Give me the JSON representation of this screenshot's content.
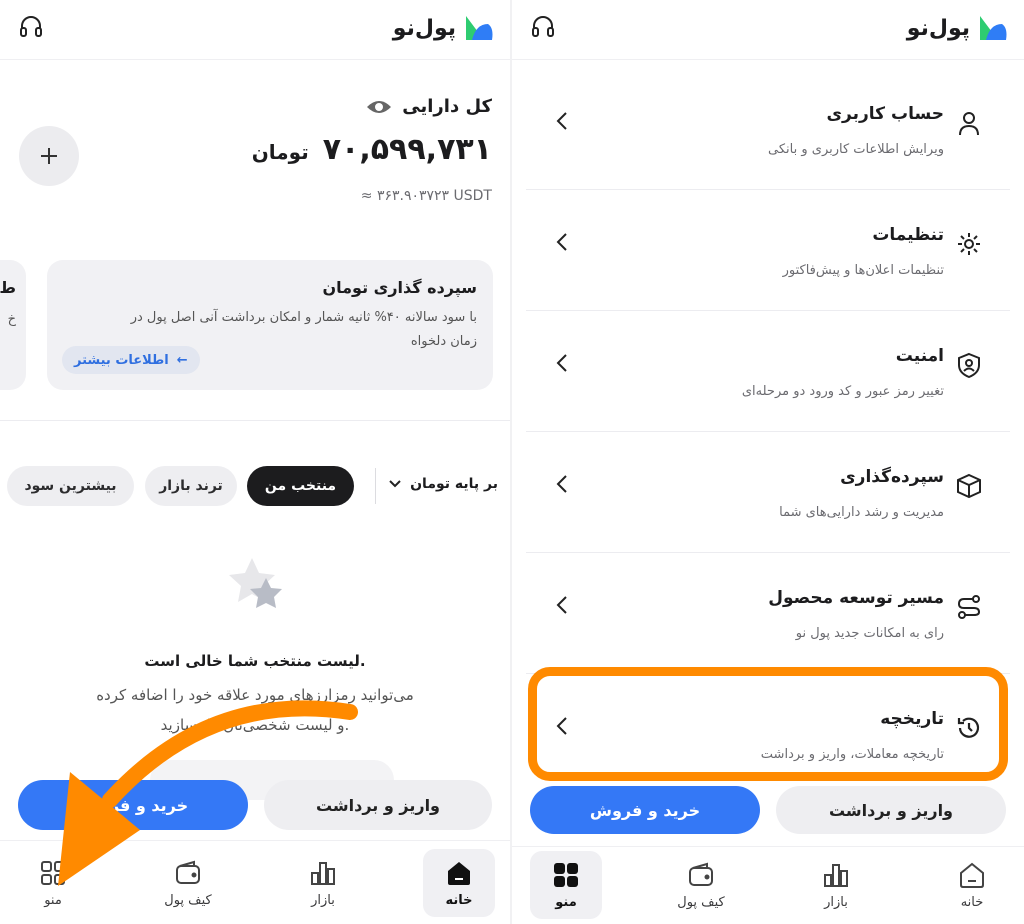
{
  "brand": {
    "name": "پول‌نو"
  },
  "left": {
    "assets": {
      "label": "کل دارایی",
      "amount": "۷۰,۵۹۹,۷۳۱",
      "currency": "تومان",
      "usdt": "≈ ۳۶۳.۹۰۳۷۲۳ USDT"
    },
    "promo": {
      "title": "سپرده گذاری تومان",
      "line1": "با سود سالانه ۴۰% ثانیه شمار و امکان برداشت آنی اصل پول در",
      "line2": "زمان دلخواه",
      "link": "اطلاعات بیشتر",
      "edge_title": "ط",
      "edge_line": "خ"
    },
    "filters": {
      "base": "بر پایه تومان",
      "chips": [
        "منتخب من",
        "ترند بازار",
        "بیشترین سود"
      ]
    },
    "empty": {
      "title": "لیست منتخب شما خالی است.",
      "line1": "می‌توانید رمزارزهای مورد علاقه خود را اضافه کرده",
      "line2": "و لیست شخصی‌تان را بسازید."
    },
    "actions": {
      "deposit": "واریز و برداشت",
      "trade": "خرید و فروش"
    }
  },
  "right": {
    "menu": [
      {
        "title": "حساب کاربری",
        "subtitle": "ویرایش اطلاعات کاربری و بانکی",
        "icon": "user-icon"
      },
      {
        "title": "تنظیمات",
        "subtitle": "تنظیمات اعلان‌ها و پیش‌فاکتور",
        "icon": "gear-icon"
      },
      {
        "title": "امنیت",
        "subtitle": "تغییر رمز عبور و کد ورود دو مرحله‌ای",
        "icon": "shield-user-icon"
      },
      {
        "title": "سپرده‌گذاری",
        "subtitle": "مدیریت و رشد دارایی‌های شما",
        "icon": "box-icon"
      },
      {
        "title": "مسیر توسعه محصول",
        "subtitle": "رای به امکانات جدید پول نو",
        "icon": "route-icon"
      },
      {
        "title": "تاریخچه",
        "subtitle": "تاریخچه معاملات، واریز و برداشت",
        "icon": "history-icon"
      }
    ],
    "actions": {
      "deposit": "واریز و برداشت",
      "trade": "خرید و فروش"
    }
  },
  "tabs": [
    {
      "label": "خانه",
      "icon": "home-icon"
    },
    {
      "label": "بازار",
      "icon": "market-chart-icon"
    },
    {
      "label": "کیف پول",
      "icon": "wallet-icon"
    },
    {
      "label": "منو",
      "icon": "grid-menu-icon"
    }
  ],
  "colors": {
    "accent_blue": "#3478f6",
    "annotation_orange": "#ff8a00",
    "chip_dark": "#1c1c1e"
  }
}
